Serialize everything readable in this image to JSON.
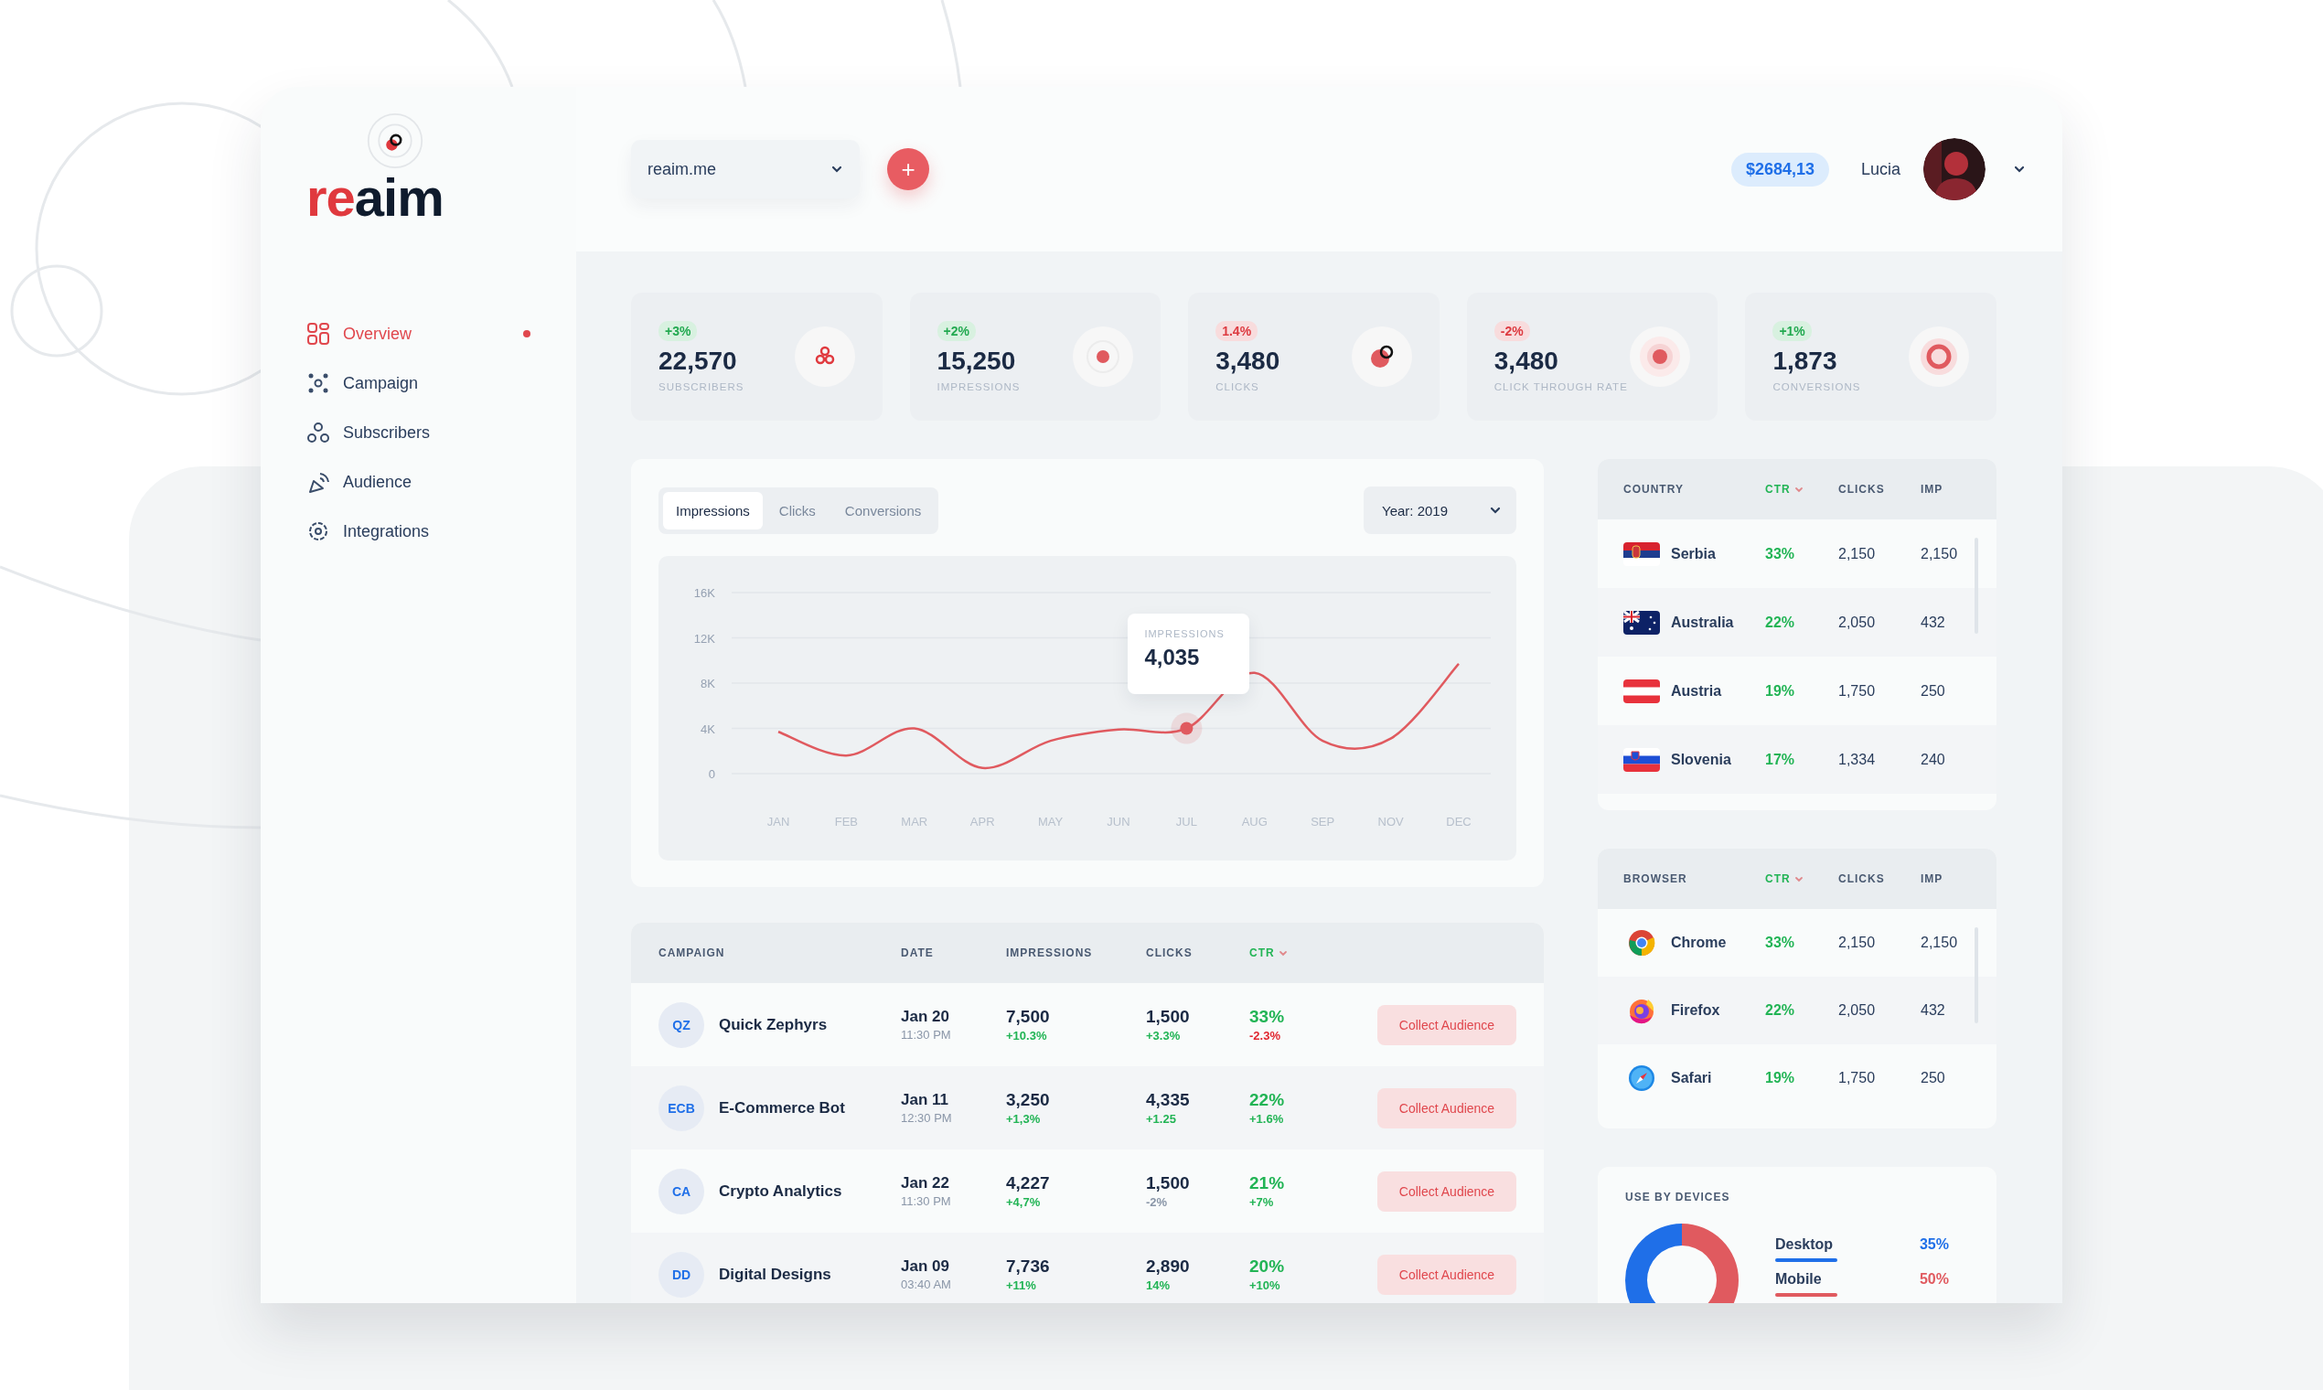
{
  "logo": {
    "parts": [
      {
        "text": "re",
        "color": "#e0393e"
      },
      {
        "text": "aim",
        "color": "#0f1b2d"
      }
    ]
  },
  "sidebar": {
    "items": [
      {
        "label": "Overview",
        "kind": "grid",
        "selected": true
      },
      {
        "label": "Campaign",
        "kind": "dots",
        "selected": false
      },
      {
        "label": "Subscribers",
        "kind": "people",
        "selected": false
      },
      {
        "label": "Audience",
        "kind": "dish",
        "selected": false
      },
      {
        "label": "Integrations",
        "kind": "gear",
        "selected": false
      }
    ]
  },
  "header": {
    "site_select": {
      "value": "reaim.me"
    },
    "add_button": "+",
    "balance": "$2684,13",
    "user": "Lucia"
  },
  "stats": [
    {
      "change": "+3%",
      "negative": false,
      "value": "22,570",
      "label": "SUBSCRIBERS",
      "kind": "subscribers"
    },
    {
      "change": "+2%",
      "negative": false,
      "value": "15,250",
      "label": "IMPRESSIONS",
      "kind": "impressions"
    },
    {
      "change": "1.4%",
      "negative": true,
      "value": "3,480",
      "label": "CLICKS",
      "kind": "clicks"
    },
    {
      "change": "-2%",
      "negative": true,
      "value": "3,480",
      "label": "CLICK THROUGH RATE",
      "kind": "ctr"
    },
    {
      "change": "+1%",
      "negative": false,
      "value": "1,873",
      "label": "CONVERSIONS",
      "kind": "conversions"
    }
  ],
  "chart_panel": {
    "tabs": [
      {
        "label": "Impressions",
        "selected": true
      },
      {
        "label": "Clicks",
        "selected": false
      },
      {
        "label": "Conversions",
        "selected": false
      }
    ],
    "year_select": {
      "value": "Year: 2019"
    },
    "tooltip": {
      "label": "IMPRESSIONS"
    },
    "chart_data": {
      "type": "line",
      "categories": [
        "JAN",
        "FEB",
        "MAR",
        "APR",
        "MAY",
        "JUN",
        "JUL",
        "AUG",
        "SEP",
        "NOV",
        "DEC"
      ],
      "series": [
        {
          "color": "#e05a5f",
          "values": [
            3700,
            1600,
            4000,
            500,
            2900,
            3900,
            4000,
            8900,
            2900,
            3100,
            9700
          ]
        }
      ],
      "ylim": [
        0,
        16000
      ],
      "yticks": [
        {
          "value": 0,
          "label": "0"
        },
        {
          "value": 4000,
          "label": "4K"
        },
        {
          "value": 8000,
          "label": "8K"
        },
        {
          "value": 12000,
          "label": "12K"
        },
        {
          "value": 16000,
          "label": "16K"
        }
      ],
      "grid": true,
      "annotations": [
        {
          "x": "JUL",
          "y": 4000,
          "text": "4,035"
        }
      ]
    }
  },
  "campaigns": {
    "columns": [
      {
        "label": "CAMPAIGN",
        "sorted": false
      },
      {
        "label": "DATE",
        "sorted": false
      },
      {
        "label": "IMPRESSIONS",
        "sorted": false
      },
      {
        "label": "CLICKS",
        "sorted": false
      },
      {
        "label": "CTR",
        "sorted": true
      }
    ],
    "rows": [
      {
        "initials": "QZ",
        "name": "Quick Zephyrs",
        "date": "Jan 20",
        "time": "11:30 PM",
        "impressions": "7,500",
        "impressions_change": {
          "text": "+10.3%",
          "color": "#22b455"
        },
        "clicks": "1,500",
        "clicks_change": {
          "text": "+3.3%",
          "color": "#22b455"
        },
        "ctr": "33%",
        "ctr_change": {
          "text": "-2.3%",
          "color": "#e0262f"
        },
        "action": "Collect Audience"
      },
      {
        "initials": "ECB",
        "name": "E-Commerce Bot",
        "date": "Jan 11",
        "time": "12:30 PM",
        "impressions": "3,250",
        "impressions_change": {
          "text": "+1,3%",
          "color": "#22b455"
        },
        "clicks": "4,335",
        "clicks_change": {
          "text": "+1.25",
          "color": "#22b455"
        },
        "ctr": "22%",
        "ctr_change": {
          "text": "+1.6%",
          "color": "#22b455"
        },
        "action": "Collect Audience"
      },
      {
        "initials": "CA",
        "name": "Crypto Analytics",
        "date": "Jan 22",
        "time": "11:30 PM",
        "impressions": "4,227",
        "impressions_change": {
          "text": "+4,7%",
          "color": "#22b455"
        },
        "clicks": "1,500",
        "clicks_change": {
          "text": "-2%",
          "color": "#8a96a8"
        },
        "ctr": "21%",
        "ctr_change": {
          "text": "+7%",
          "color": "#22b455"
        },
        "action": "Collect Audience"
      },
      {
        "initials": "DD",
        "name": "Digital Designs",
        "date": "Jan 09",
        "time": "03:40 AM",
        "impressions": "7,736",
        "impressions_change": {
          "text": "+11%",
          "color": "#22b455"
        },
        "clicks": "2,890",
        "clicks_change": {
          "text": "14%",
          "color": "#22b455"
        },
        "ctr": "20%",
        "ctr_change": {
          "text": "+10%",
          "color": "#22b455"
        },
        "action": "Collect Audience"
      }
    ]
  },
  "countries": {
    "columns": [
      {
        "label": "COUNTRY",
        "sorted": false
      },
      {
        "label": "CTR",
        "sorted": true
      },
      {
        "label": "CLICKS",
        "sorted": false
      },
      {
        "label": "IMP",
        "sorted": false
      }
    ],
    "rows": [
      {
        "kind": "rs",
        "name": "Serbia",
        "ctr": "33%",
        "clicks": "2,150",
        "imp": "2,150"
      },
      {
        "kind": "au",
        "name": "Australia",
        "ctr": "22%",
        "clicks": "2,050",
        "imp": "432"
      },
      {
        "kind": "at",
        "name": "Austria",
        "ctr": "19%",
        "clicks": "1,750",
        "imp": "250"
      },
      {
        "kind": "si",
        "name": "Slovenia",
        "ctr": "17%",
        "clicks": "1,334",
        "imp": "240"
      }
    ]
  },
  "browsers": {
    "columns": [
      {
        "label": "BROWSER",
        "sorted": false
      },
      {
        "label": "CTR",
        "sorted": true
      },
      {
        "label": "CLICKS",
        "sorted": false
      },
      {
        "label": "IMP",
        "sorted": false
      }
    ],
    "rows": [
      {
        "kind": "chrome",
        "name": "Chrome",
        "ctr": "33%",
        "clicks": "2,150",
        "imp": "2,150"
      },
      {
        "kind": "firefox",
        "name": "Firefox",
        "ctr": "22%",
        "clicks": "2,050",
        "imp": "432"
      },
      {
        "kind": "safari",
        "name": "Safari",
        "ctr": "19%",
        "clicks": "1,750",
        "imp": "250"
      }
    ]
  },
  "devices": {
    "title": "USE BY DEVICES",
    "legend": [
      {
        "label": "Desktop",
        "value": "35%",
        "color": "#1f6fe8"
      },
      {
        "label": "Mobile",
        "value": "50%",
        "color": "#e05a5f"
      }
    ]
  }
}
